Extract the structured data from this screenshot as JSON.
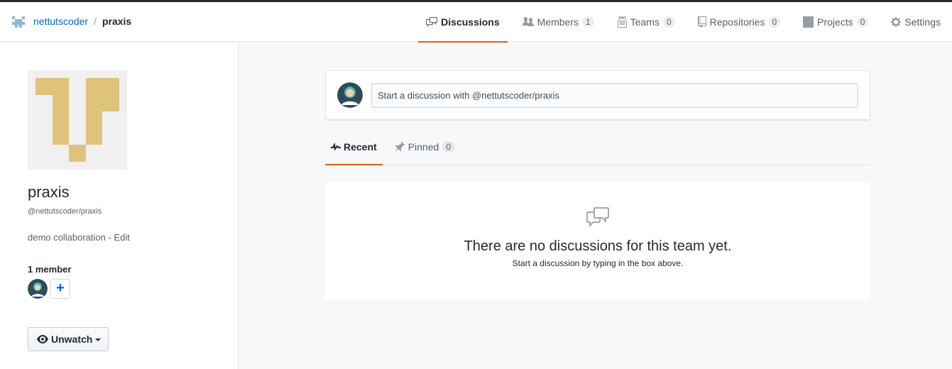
{
  "breadcrumb": {
    "org": "nettutscoder",
    "separator": "/",
    "team": "praxis"
  },
  "nav": {
    "tabs": [
      {
        "label": "Discussions",
        "count": null,
        "selected": true,
        "icon": "comment-discussion-icon"
      },
      {
        "label": "Members",
        "count": "1",
        "icon": "people-icon"
      },
      {
        "label": "Teams",
        "count": "0",
        "icon": "jersey-icon"
      },
      {
        "label": "Repositories",
        "count": "0",
        "icon": "repo-icon"
      },
      {
        "label": "Projects",
        "count": "0",
        "icon": "project-icon"
      },
      {
        "label": "Settings",
        "count": null,
        "icon": "gear-icon"
      }
    ]
  },
  "sidebar": {
    "name": "praxis",
    "slug": "@nettutscoder/praxis",
    "description": "demo collaboration",
    "desc_sep": " - ",
    "edit_label": "Edit",
    "member_count": "1 member",
    "add_member_label": "+",
    "watch_label": "Unwatch"
  },
  "composer": {
    "placeholder": "Start a discussion with @nettutscoder/praxis"
  },
  "subtabs": [
    {
      "label": "Recent",
      "selected": true,
      "icon": "pulse-icon"
    },
    {
      "label": "Pinned",
      "count": "0",
      "icon": "pin-icon"
    }
  ],
  "blankslate": {
    "title": "There are no discussions for this team yet.",
    "subtitle": "Start a discussion by typing in the box above."
  },
  "colors": {
    "accent": "#e36209",
    "link": "#0366d6",
    "team_avatar": "#dfc37a"
  }
}
